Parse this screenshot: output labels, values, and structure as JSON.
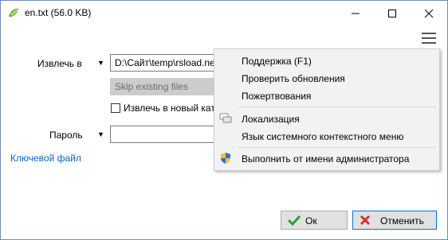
{
  "window": {
    "title": "en.txt (56.0 KB)"
  },
  "colors": {
    "ok_check": "#2e9e2e",
    "cancel_x": "#d83030",
    "link": "#0066cc",
    "app_icon": "#5aa82a"
  },
  "icons": {
    "app": "pea-pod-icon",
    "minimize": "minimize-icon",
    "maximize": "maximize-icon",
    "close": "close-icon",
    "menu": "hamburger-menu-icon",
    "localization": "speech-bubbles-icon",
    "admin": "uac-shield-icon",
    "ok": "check-icon",
    "cancel": "x-icon"
  },
  "form": {
    "extract_label": "Извлечь в",
    "extract_path": "D:\\Сайт\\temp\\rsload.ne",
    "overwrite_mode": "Skip existing files",
    "new_folder_label": "Извлечь в новый кат",
    "password_label": "Пароль",
    "password_value": "",
    "keyfile_link": "Ключевой файл"
  },
  "menu": {
    "items": [
      "Поддержка (F1)",
      "Проверить обновления",
      "Пожертвования",
      "Локализация",
      "Язык системного контекстного меню",
      "Выполнить от имени администратора"
    ]
  },
  "buttons": {
    "ok": "Ок",
    "cancel": "Отменить"
  }
}
